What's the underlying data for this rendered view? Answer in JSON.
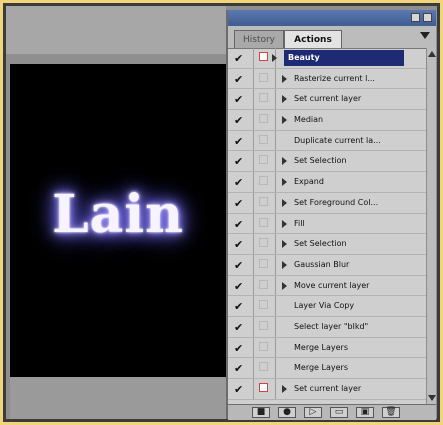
{
  "image_window": {
    "text": "Lain"
  },
  "palette": {
    "tabs": [
      "History",
      "Actions"
    ],
    "active_tab": "Actions",
    "items": [
      {
        "label": "Beauty",
        "type": "set",
        "checked": true,
        "dialog": "on"
      },
      {
        "label": "Rasterize current l...",
        "type": "step",
        "checked": true,
        "dialog": "off",
        "expandable": true
      },
      {
        "label": "Set current layer",
        "type": "step",
        "checked": true,
        "dialog": "off",
        "expandable": true
      },
      {
        "label": "Median",
        "type": "step",
        "checked": true,
        "dialog": "off",
        "expandable": true
      },
      {
        "label": "Duplicate current la...",
        "type": "step",
        "checked": true,
        "dialog": "off",
        "expandable": false
      },
      {
        "label": "Set Selection",
        "type": "step",
        "checked": true,
        "dialog": "off",
        "expandable": true
      },
      {
        "label": "Expand",
        "type": "step",
        "checked": true,
        "dialog": "off",
        "expandable": true
      },
      {
        "label": "Set Foreground Col...",
        "type": "step",
        "checked": true,
        "dialog": "off",
        "expandable": true
      },
      {
        "label": "Fill",
        "type": "step",
        "checked": true,
        "dialog": "off",
        "expandable": true
      },
      {
        "label": "Set Selection",
        "type": "step",
        "checked": true,
        "dialog": "off",
        "expandable": true
      },
      {
        "label": "Gaussian Blur",
        "type": "step",
        "checked": true,
        "dialog": "off",
        "expandable": true
      },
      {
        "label": "Move current layer",
        "type": "step",
        "checked": true,
        "dialog": "off",
        "expandable": true
      },
      {
        "label": "Layer Via Copy",
        "type": "step",
        "checked": true,
        "dialog": "off",
        "expandable": false
      },
      {
        "label": "Select layer \"blkd\"",
        "type": "step",
        "checked": true,
        "dialog": "off",
        "expandable": false
      },
      {
        "label": "Merge Layers",
        "type": "step",
        "checked": true,
        "dialog": "off",
        "expandable": false
      },
      {
        "label": "Merge Layers",
        "type": "step",
        "checked": true,
        "dialog": "off",
        "expandable": false
      },
      {
        "label": "Set current layer",
        "type": "step",
        "checked": true,
        "dialog": "on",
        "expandable": true
      }
    ],
    "footer_buttons": [
      {
        "name": "stop-button",
        "glyph": "■"
      },
      {
        "name": "record-button",
        "glyph": "●"
      },
      {
        "name": "play-button",
        "glyph": "▷"
      },
      {
        "name": "new-set-button",
        "glyph": "▭"
      },
      {
        "name": "new-action-button",
        "glyph": "▣"
      },
      {
        "name": "delete-button",
        "glyph": "🗑"
      }
    ]
  }
}
